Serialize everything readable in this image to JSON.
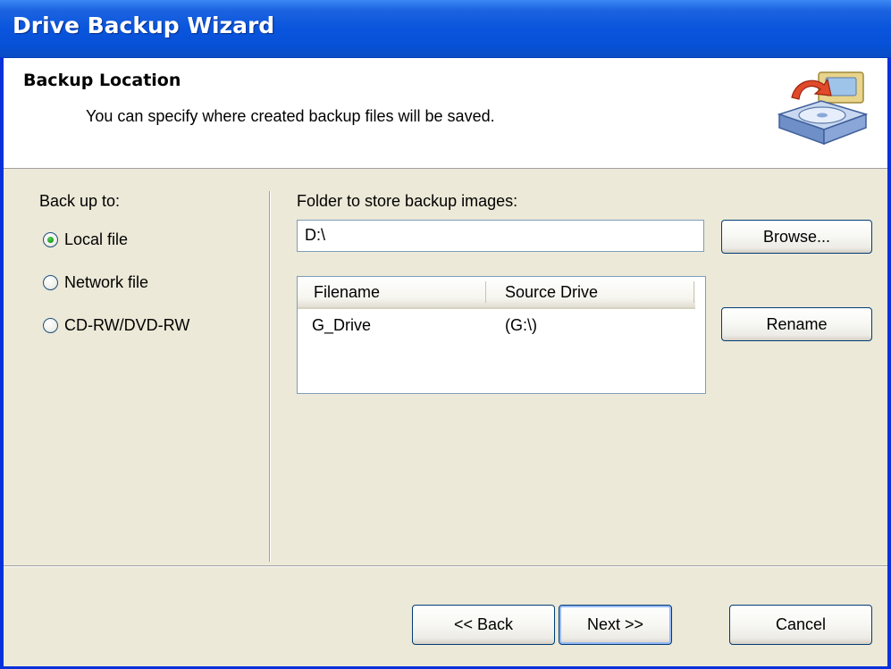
{
  "window": {
    "title": "Drive Backup Wizard"
  },
  "header": {
    "title": "Backup Location",
    "subtitle": "You can specify where created backup files will be saved.",
    "icon": "backup-drive-icon"
  },
  "backup_to": {
    "label": "Back up to:",
    "options": [
      {
        "label": "Local file",
        "checked": true
      },
      {
        "label": "Network file",
        "checked": false
      },
      {
        "label": "CD-RW/DVD-RW",
        "checked": false
      }
    ]
  },
  "folder": {
    "label": "Folder to store backup images:",
    "value": "D:\\",
    "browse_label": "Browse..."
  },
  "file_list": {
    "columns": [
      "Filename",
      "Source Drive"
    ],
    "rows": [
      {
        "filename": "G_Drive",
        "source": "(G:\\)"
      }
    ],
    "rename_label": "Rename"
  },
  "footer": {
    "back_label": "<< Back",
    "next_label": "Next >>",
    "cancel_label": "Cancel"
  },
  "colors": {
    "titlebar": "#0a55dd",
    "dialog_bg": "#ece9d8",
    "radio_checked": "#21a121"
  }
}
